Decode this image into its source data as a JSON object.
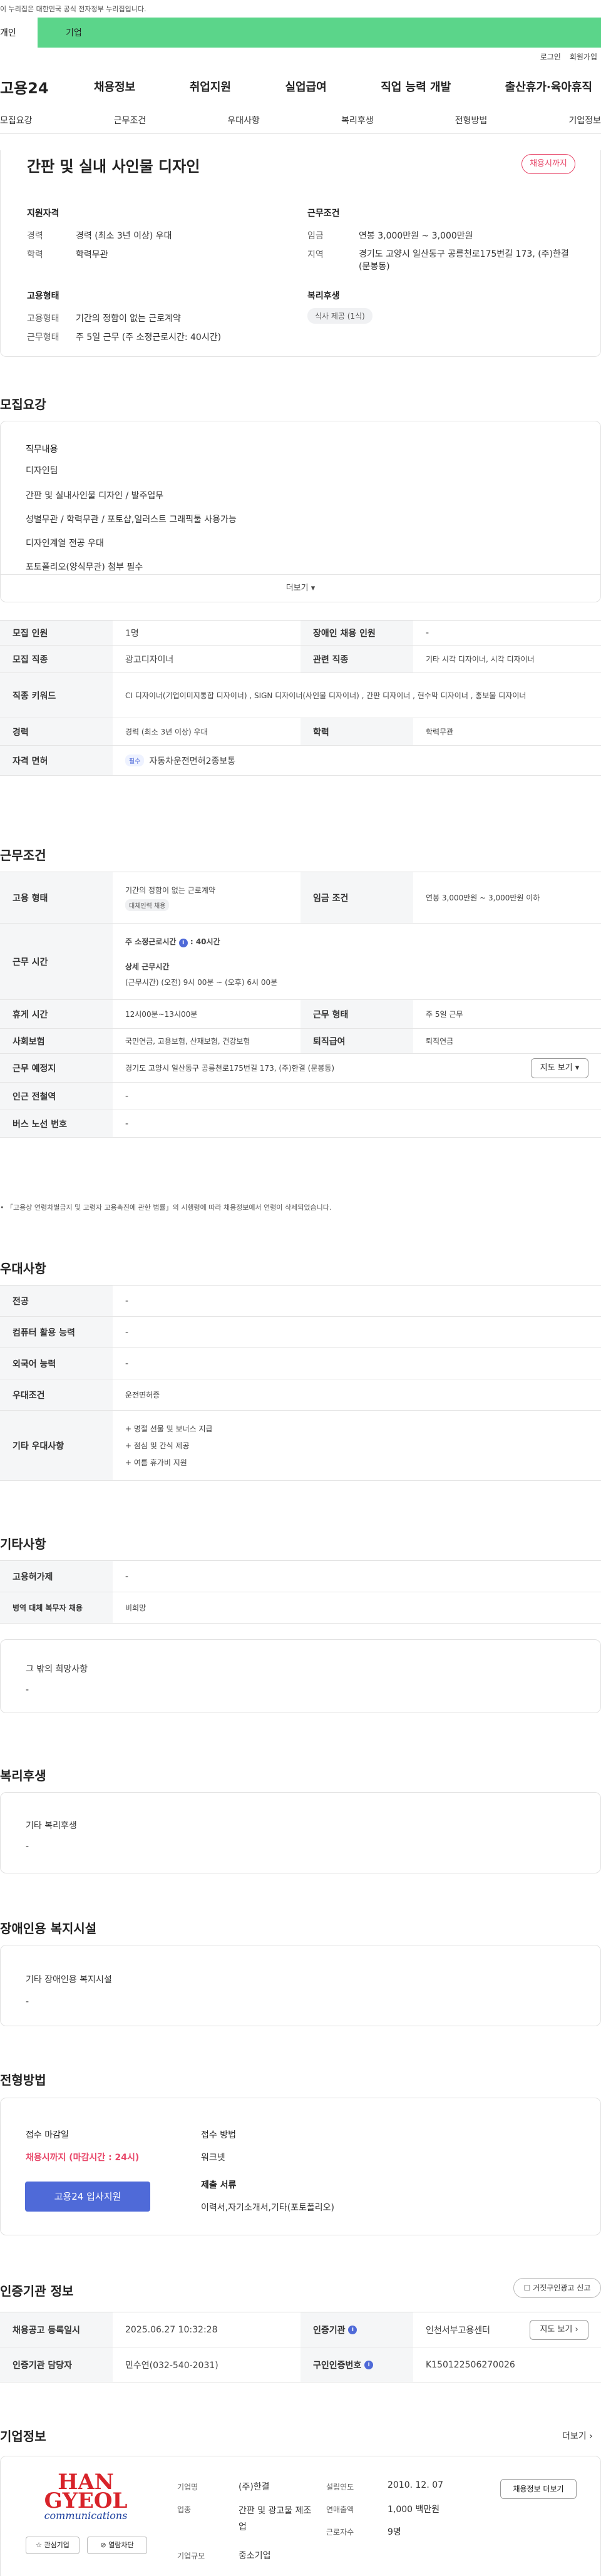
{
  "gov_text": "이 누리집은 대한민국 공식 전자정부 누리집입니다.",
  "top_tabs": {
    "personal": "개인",
    "company": "기업"
  },
  "util": {
    "login": "로그인",
    "join": "회원가입"
  },
  "logo": "고용24",
  "gnb": [
    "채용정보",
    "취업지원",
    "실업급여",
    "직업 능력 개발",
    "출산휴가·육아휴직"
  ],
  "anchors": [
    "모집요강",
    "근무조건",
    "우대사항",
    "복리후생",
    "전형방법",
    "기업정보"
  ],
  "summary": {
    "title": "간판 및 실내 사인물 디자인",
    "badge": "채용시까지",
    "qual_title": "지원자격",
    "career_k": "경력",
    "career_v": "경력 (최소 3년 이상) 우대",
    "edu_k": "학력",
    "edu_v": "학력무관",
    "cond_title": "근무조건",
    "wage_k": "임금",
    "wage_v": "연봉 3,000만원 ~ 3,000만원",
    "region_k": "지역",
    "region_v": "경기도 고양시 일산동구 공릉천로175번길 173, (주)한결 (문봉동)",
    "emp_title": "고용형태",
    "emp_k": "고용형태",
    "emp_v": "기간의 정함이 없는 근로계약",
    "work_k": "근무형태",
    "work_v": "주 5일 근무 (주 소정근로시간: 40시간)",
    "welfare_title": "복리후생",
    "welfare_chip": "식사 제공 (1식)"
  },
  "recruit": {
    "title": "모집요강",
    "duty_title": "직무내용",
    "duties": [
      "디자인팀",
      "간판 및 실내사인물 디자인 / 발주업무",
      "성별무관 / 학력무관 / 포토샵,일러스트 그래픽툴 사용가능",
      "디자인계열 전공 우대",
      "포토폴리오(양식무관) 첨부 필수"
    ],
    "more": "더보기",
    "rows": [
      {
        "k1": "모집 인원",
        "v1": "1명",
        "k2": "장애인 채용 인원",
        "v2": "-"
      },
      {
        "k1": "모집 직종",
        "v1": "광고디자이너",
        "k2": "관련 직종",
        "v2": "기타 시각 디자이너, 시각 디자이너"
      },
      {
        "k1": "직종 키워드",
        "v1": "CI 디자이너(기업이미지통합 디자이너) , SIGN 디자이너(사인물 디자이너) , 간판 디자이너 , 현수막 디자이너 , 홍보물 디자이너"
      },
      {
        "k1": "경력",
        "v1": "경력 (최소 3년 이상) 우대",
        "k2": "학력",
        "v2": "학력무관"
      },
      {
        "k1": "자격 면허",
        "chip": "필수",
        "v1": "자동차운전면허2종보통"
      }
    ]
  },
  "conditions": {
    "title": "근무조건",
    "emp_k": "고용 형태",
    "emp_v": "기간의 정함이 없는 근로계약",
    "emp_chip": "대체인력 채용",
    "wage_k": "임금 조건",
    "wage_v": "연봉 3,000만원 ~ 3,000만원 이하",
    "time_k": "근무 시간",
    "time_week": "주 소정근로시간",
    "time_week_v": ": 40시간",
    "time_detail": "상세 근무시간",
    "time_detail_v": "(근무시간) (오전) 9시 00분 ~ (오후) 6시 00분",
    "rest_k": "휴게 시간",
    "rest_v": "12시00분~13시00분",
    "form_k": "근무 형태",
    "form_v": "주 5일 근무",
    "ins_k": "사회보험",
    "ins_v": "국민연금, 고용보험, 산재보험, 건강보험",
    "ret_k": "퇴직급여",
    "ret_v": "퇴직연금",
    "place_k": "근무 예정지",
    "place_v": "경기도 고양시 일산동구 공릉천로175번길 173, (주)한결 (문봉동)",
    "map": "지도 보기",
    "sub_k": "인근 전철역",
    "sub_v": "-",
    "bus_k": "버스 노선 번호",
    "bus_v": "-",
    "note": "「고용상 연령차별금지 및 고령자 고용촉진에 관한 법률」의 시행령에 따라 채용정보에서 연령이 삭제되었습니다."
  },
  "pref": {
    "title": "우대사항",
    "rows": [
      {
        "k": "전공",
        "v": "-"
      },
      {
        "k": "컴퓨터 활용 능력",
        "v": "-"
      },
      {
        "k": "외국어 능력",
        "v": "-"
      },
      {
        "k": "우대조건",
        "v": "운전면허증"
      }
    ],
    "etc_k": "기타 우대사항",
    "etc": [
      "+ 명절 선물 및 보너스 지급",
      "+ 점심 및 간식 제공",
      "+ 여름 휴가비 지원"
    ]
  },
  "others": {
    "title": "기타사항",
    "rows": [
      {
        "k": "고용허가제",
        "v": "-"
      },
      {
        "k": "병역 대체 복무자 채용",
        "v": "비희망"
      }
    ],
    "hope_k": "그 밖의 희망사항",
    "hope_v": "-"
  },
  "welfare": {
    "title": "복리후생",
    "k": "기타 복리후생",
    "v": "-"
  },
  "disabled": {
    "title": "장애인용 복지시설",
    "k": "기타 장애인용 복지시설",
    "v": "-"
  },
  "process": {
    "title": "전형방법",
    "deadline_k": "접수 마감일",
    "deadline_v": "채용시까지 (마감시간 : 24시)",
    "apply": "고용24 입사지원",
    "method_k": "접수 방법",
    "method_v": "워크넷",
    "docs_k": "제출 서류",
    "docs_v": "이력서,자기소개서,기타(포토폴리오)"
  },
  "cert": {
    "title": "인증기관 정보",
    "report": "거짓구인광고 신고",
    "reg_k": "채용공고 등록일시",
    "reg_v": "2025.06.27 10:32:28",
    "org_k": "인증기관",
    "org_v": "인천서부고용센터",
    "map": "지도 보기",
    "mgr_k": "인증기관 담당자",
    "mgr_v": "민수연(032-540-2031)",
    "num_k": "구인인증번호",
    "num_v": "K150122506270026"
  },
  "company": {
    "title": "기업정보",
    "more": "더보기",
    "logo_top": "HAN",
    "logo_mid": "GYEOL",
    "logo_bot": "communications",
    "fav": "관심기업",
    "block": "열람차단",
    "name_k": "기업명",
    "name_v": "(주)한결",
    "ind_k": "업종",
    "ind_v": "간판 및 광고물 제조업",
    "size_k": "기업규모",
    "size_v": "중소기업",
    "est_k": "설립연도",
    "est_v": "2010. 12. 07",
    "rev_k": "연매출액",
    "rev_v": "1,000 백만원",
    "emp_k": "근로자수",
    "emp_v": "9명",
    "jobs": "채용정보 더보기"
  },
  "colors": {
    "accent": "#4f6ad8",
    "green": "#5bd58a",
    "red": "#e8486a"
  }
}
